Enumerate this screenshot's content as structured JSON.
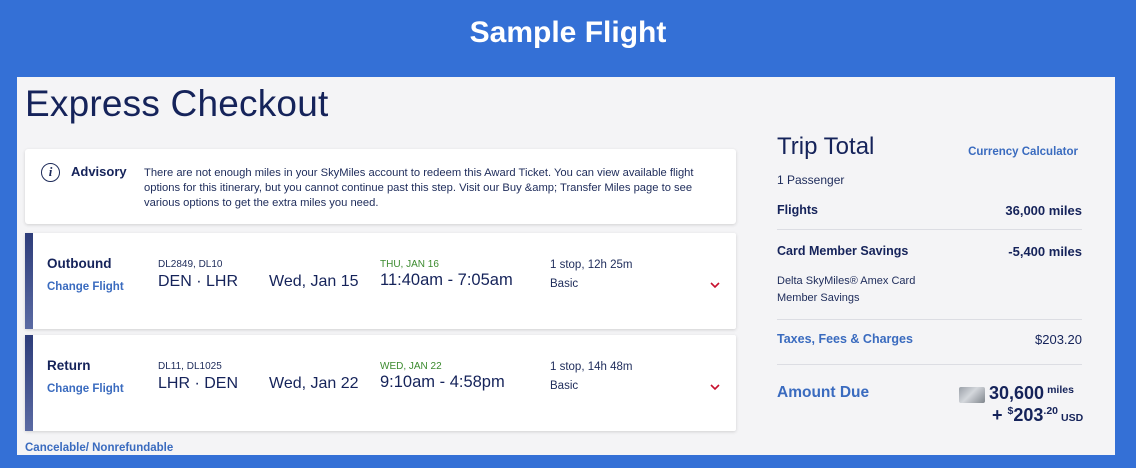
{
  "banner": {
    "title": "Sample Flight"
  },
  "page": {
    "title": "Express Checkout"
  },
  "advisory": {
    "title": "Advisory",
    "text": "There are not enough miles in your SkyMiles account to redeem this Award Ticket. You can view available flight options for this itinerary, but you cannot continue past this step. Visit our Buy &amp; Transfer Miles page to see various options to get the extra miles you need."
  },
  "flights": [
    {
      "direction": "Outbound",
      "change_label": "Change Flight",
      "flight_numbers": "DL2849, DL10",
      "route": "DEN · LHR",
      "depart_date": "Wed, Jan 15",
      "arrive_day": "THU, JAN 16",
      "times": "11:40am - 7:05am",
      "stops": "1 stop, 12h 25m",
      "fare_class": "Basic"
    },
    {
      "direction": "Return",
      "change_label": "Change Flight",
      "flight_numbers": "DL11, DL1025",
      "route": "LHR · DEN",
      "depart_date": "Wed, Jan 22",
      "arrive_day": "WED, JAN 22",
      "times": "9:10am - 4:58pm",
      "stops": "1 stop, 14h 48m",
      "fare_class": "Basic"
    }
  ],
  "cancel_note": "Cancelable/ Nonrefundable",
  "summary": {
    "title": "Trip Total",
    "currency_link": "Currency Calculator",
    "passengers": "1 Passenger",
    "flights_label": "Flights",
    "flights_value": "36,000 miles",
    "savings_label": "Card Member Savings",
    "savings_value": "-5,400 miles",
    "savings_sub": "Delta SkyMiles® Amex Card Member Savings",
    "taxes_label": "Taxes, Fees & Charges",
    "taxes_value": "$203.20",
    "amount_label": "Amount Due",
    "due_miles": "30,600",
    "due_miles_unit": "miles",
    "due_cash_prefix": "+ ",
    "due_cash_symbol": "$",
    "due_cash_whole": "203",
    "due_cash_cents": ".20",
    "due_cash_currency": "USD"
  },
  "colors": {
    "brand_blue": "#3470d6",
    "navy": "#15235a",
    "link_blue": "#3a6bbf",
    "arrival_green": "#3b8a2e",
    "expand_red": "#c8102e"
  }
}
